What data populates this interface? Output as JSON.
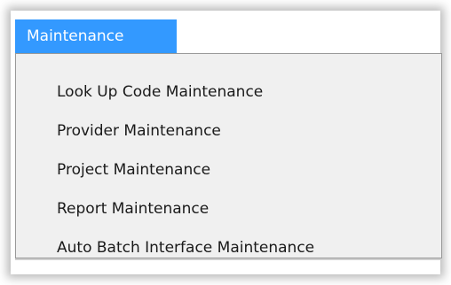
{
  "menu": {
    "title": "Maintenance",
    "items": [
      {
        "label": "Look Up Code Maintenance"
      },
      {
        "label": "Provider Maintenance"
      },
      {
        "label": "Project Maintenance"
      },
      {
        "label": "Report Maintenance"
      },
      {
        "label": "Auto Batch Interface Maintenance"
      }
    ]
  },
  "colors": {
    "menu_header_bg": "#3399ff",
    "menu_header_text": "#ffffff",
    "dropdown_bg": "#f0f0f0",
    "dropdown_border": "#999999",
    "item_text": "#1a1a1a"
  }
}
